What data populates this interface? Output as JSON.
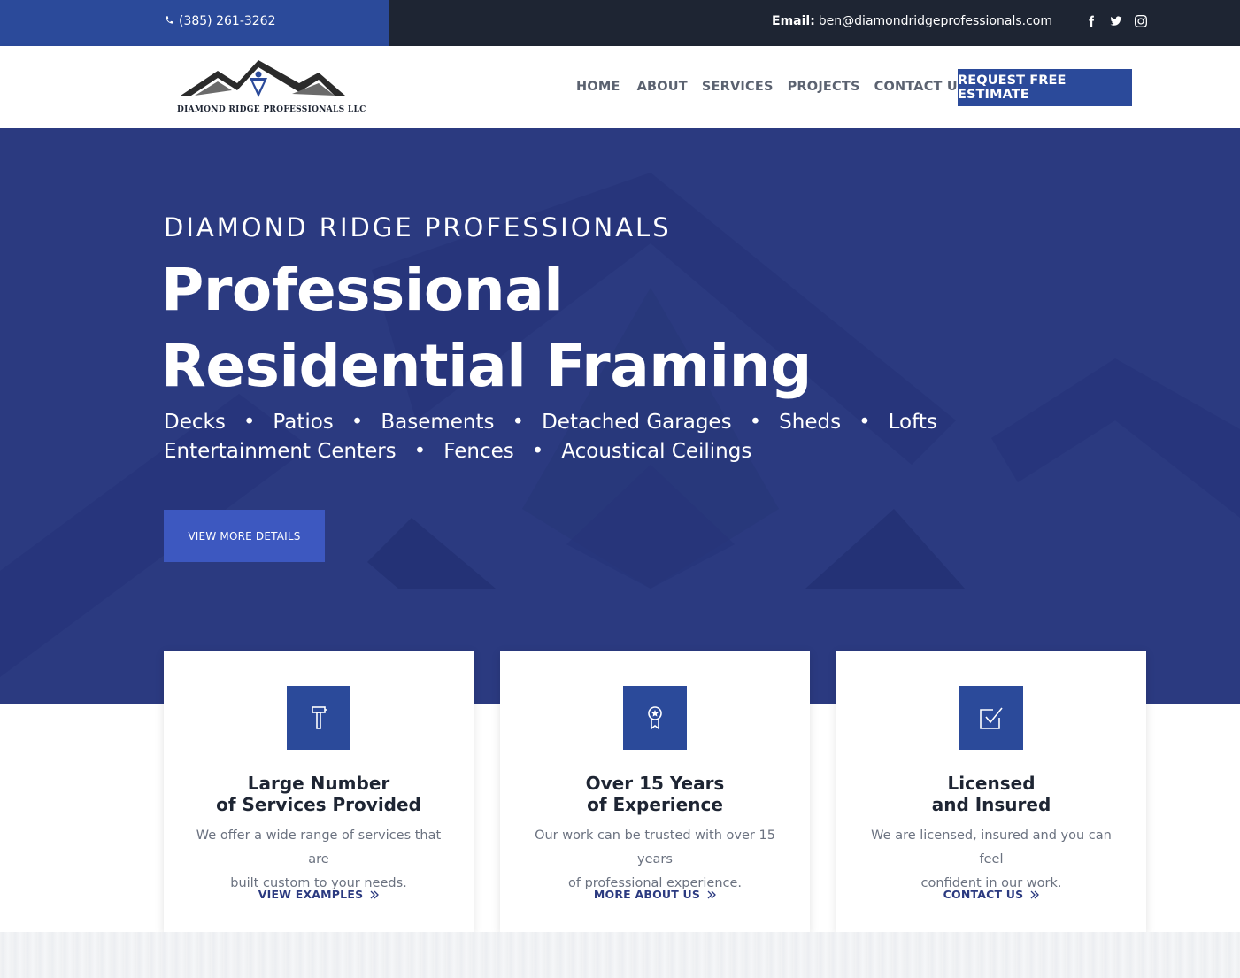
{
  "topbar": {
    "phone": "(385) 261-3262",
    "email_label": "Email:",
    "email": "ben@diamondridgeprofessionals.com",
    "social_icons": [
      "facebook-icon",
      "twitter-icon",
      "instagram-icon"
    ]
  },
  "header": {
    "logo_text": "DIAMOND RIDGE PROFESSIONALS LLC",
    "nav": [
      "HOME",
      "ABOUT",
      "SERVICES",
      "PROJECTS",
      "CONTACT US"
    ],
    "cta": "REQUEST FREE ESTIMATE"
  },
  "hero": {
    "subtitle": "DIAMOND RIDGE PROFESSIONALS",
    "title_line1": "Professional",
    "title_line2": "Residential Framing",
    "services_row1": [
      "Decks",
      "Patios",
      "Basements",
      "Detached Garages",
      "Sheds",
      "Lofts"
    ],
    "services_row2": [
      "Entertainment Centers",
      "Fences",
      "Acoustical Ceilings"
    ],
    "separator": "•",
    "button": "VIEW MORE DETAILS"
  },
  "cards": [
    {
      "icon": "hammer-icon",
      "title_line1": "Large Number",
      "title_line2": "of Services Provided",
      "text_line1": "We offer a wide range of services that are",
      "text_line2": "built custom to your needs.",
      "link": "VIEW EXAMPLES"
    },
    {
      "icon": "award-icon",
      "title_line1": "Over 15 Years",
      "title_line2": "of Experience",
      "text_line1": "Our work can be trusted with over 15 years",
      "text_line2": "of professional experience.",
      "link": "MORE ABOUT US"
    },
    {
      "icon": "checkbox-icon",
      "title_line1": "Licensed",
      "title_line2": "and Insured",
      "text_line1": "We are licensed, insured and you can feel",
      "text_line2": "confident in our work.",
      "link": "CONTACT US"
    }
  ],
  "colors": {
    "brand_blue": "#2b4a9a",
    "hero_bg": "#2b3a80",
    "topbar_dark": "#1e2533",
    "button_blue": "#3d58c0"
  }
}
